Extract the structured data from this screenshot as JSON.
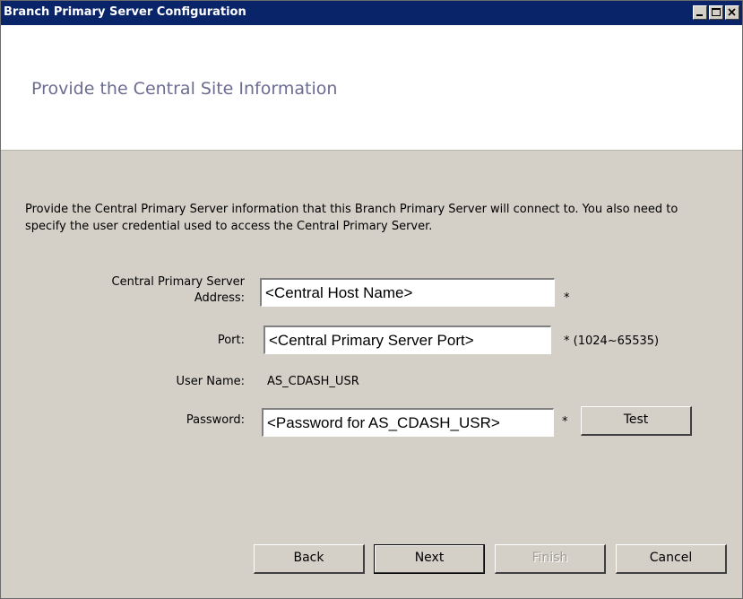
{
  "window": {
    "title": "Branch Primary Server Configuration"
  },
  "titlebar_buttons": {
    "minimize": "minimize-icon",
    "maximize": "maximize-icon",
    "close": "close-icon"
  },
  "header": {
    "title": "Provide the Central Site Information"
  },
  "description": "Provide the Central Primary Server information that this Branch Primary Server will connect to. You also need to specify the user credential used to access the Central Primary Server.",
  "form": {
    "address": {
      "label_line1": "Central Primary Server",
      "label_line2": "Address:",
      "value": "<Central Host Name>",
      "required": "*"
    },
    "port": {
      "label": "Port:",
      "value": "<Central Primary Server Port>",
      "required": "* (1024~65535)"
    },
    "username": {
      "label": "User Name:",
      "value": "AS_CDASH_USR"
    },
    "password": {
      "label": "Password:",
      "value": "<Password for AS_CDASH_USR>",
      "required": "*",
      "test_label": "Test"
    }
  },
  "buttons": {
    "back": "Back",
    "next": "Next",
    "finish": "Finish",
    "cancel": "Cancel"
  },
  "colors": {
    "titlebar": "#0a246a",
    "dialog_bg": "#d4d0c8",
    "header_title": "#6c6c92"
  }
}
